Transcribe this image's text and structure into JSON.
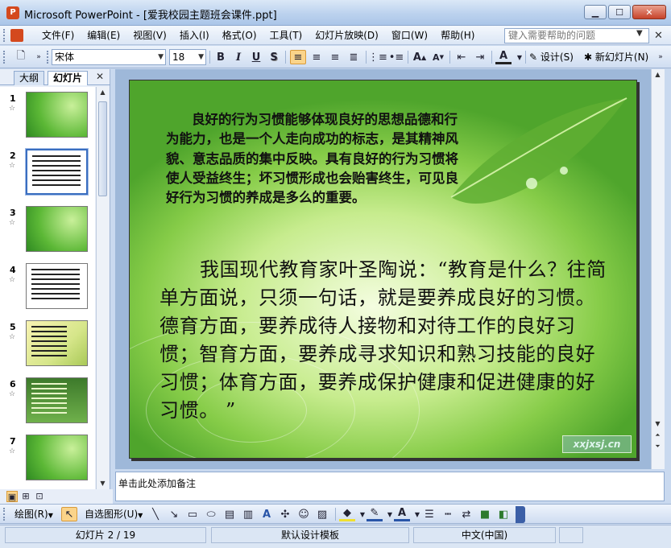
{
  "window": {
    "title": "Microsoft PowerPoint - [爱我校园主题班会课件.ppt]",
    "app_icon": "powerpoint-icon",
    "buttons": [
      "minimize",
      "maximize",
      "close"
    ]
  },
  "menubar": {
    "items": [
      "文件(F)",
      "编辑(E)",
      "视图(V)",
      "插入(I)",
      "格式(O)",
      "工具(T)",
      "幻灯片放映(D)",
      "窗口(W)",
      "帮助(H)"
    ],
    "help_placeholder": "键入需要帮助的问题"
  },
  "toolbar": {
    "font": "宋体",
    "size": "18",
    "buttons": {
      "bold": "B",
      "italic": "I",
      "underline": "U",
      "shadow": "S",
      "design": "设计(S)",
      "new_slide": "新幻灯片(N)"
    }
  },
  "panel": {
    "tabs": [
      "大纲",
      "幻灯片"
    ],
    "selected_tab": "幻灯片",
    "slides": [
      {
        "num": "1",
        "style": "green"
      },
      {
        "num": "2",
        "style": "white",
        "selected": true
      },
      {
        "num": "3",
        "style": "green"
      },
      {
        "num": "4",
        "style": "white"
      },
      {
        "num": "5",
        "style": "yellow"
      },
      {
        "num": "6",
        "style": "dark"
      },
      {
        "num": "7",
        "style": "green"
      }
    ]
  },
  "slide": {
    "paragraph1": "良好的行为习惯能够体现良好的思想品德和行为能力，也是一个人走向成功的标志，是其精神风貌、意志品质的集中反映。具有良好的行为习惯将使人受益终生；坏习惯形成也会贻害终生，可见良好行为习惯的养成是多么的重要。",
    "paragraph2": "我国现代教育家叶圣陶说：“教育是什么？往简单方面说，只须一句话，就是要养成良好的习惯。德育方面，要养成待人接物和对待工作的良好习惯；智育方面，要养成寻求知识和熟习技能的良好习惯；体育方面，要养成保护健康和促进健康的好习惯。 ”",
    "watermark": "xxjxsj.cn"
  },
  "notes": {
    "placeholder": "单击此处添加备注"
  },
  "drawing_toolbar": {
    "draw": "绘图(R)",
    "autoshapes": "自选图形(U)"
  },
  "statusbar": {
    "slide_info": "幻灯片 2 / 19",
    "template": "默认设计模板",
    "language": "中文(中国)"
  },
  "colors": {
    "accent": "#3b5fa7",
    "highlight": "#fbd48a",
    "slide_green": "#86cc48"
  }
}
